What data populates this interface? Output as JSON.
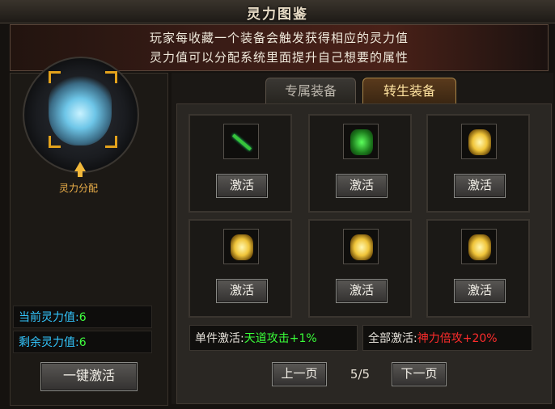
{
  "window": {
    "title": "灵力图鉴",
    "logo_text": "",
    "close_label": ""
  },
  "banner": {
    "line1": "玩家每收藏一个装备会触发获得相应的灵力值",
    "line2": "灵力值可以分配系统里面提升自己想要的属性"
  },
  "left": {
    "alloc_label": "灵力分配",
    "current_label": "当前灵力值:",
    "current_value": "6",
    "remain_label": "剩余灵力值:",
    "remain_value": "6",
    "activate_all_label": "一键激活"
  },
  "tabs": [
    {
      "label": "专属装备"
    },
    {
      "label": "转生装备"
    }
  ],
  "cells": [
    {
      "icon": "green-sword-icon",
      "button": "激活"
    },
    {
      "icon": "green-armor-icon",
      "button": "激活"
    },
    {
      "icon": "gold-armor-icon",
      "button": "激活"
    },
    {
      "icon": "gold-armor-icon",
      "button": "激活"
    },
    {
      "icon": "gold-armor-icon",
      "button": "激活"
    },
    {
      "icon": "gold-armor-icon",
      "button": "激活"
    }
  ],
  "bonus": {
    "single_label": "单件激活:",
    "single_value": "天道攻击+1%",
    "all_label": "全部激活:",
    "all_value": "神力倍攻+20%"
  },
  "pager": {
    "prev": "上一页",
    "page": "5/5",
    "next": "下一页"
  },
  "colors": {
    "accent_gold": "#e3a21c",
    "stat_key": "#33c7ff",
    "stat_value": "#3fff3f",
    "bonus_red": "#ff2c2c"
  }
}
